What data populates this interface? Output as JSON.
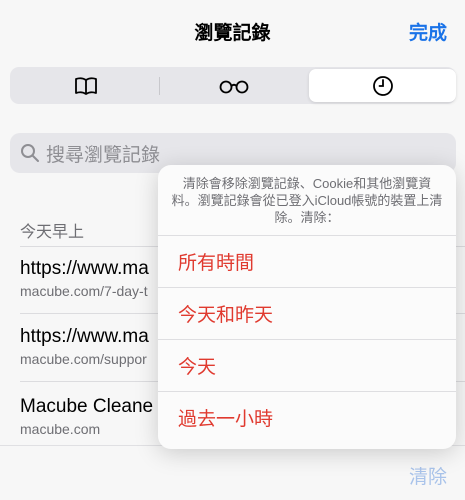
{
  "nav": {
    "title": "瀏覽記錄",
    "done_label": "完成"
  },
  "tabs": [
    {
      "icon": "book-icon"
    },
    {
      "icon": "reading-list-glasses-icon"
    },
    {
      "icon": "clock-icon",
      "selected": true
    }
  ],
  "search": {
    "placeholder": "搜尋瀏覽記錄"
  },
  "section": {
    "header": "今天早上"
  },
  "rows": [
    {
      "title": "https://www.ma",
      "subtitle": "macube.com/7-day-t"
    },
    {
      "title": "https://www.ma",
      "subtitle": "macube.com/suppor"
    },
    {
      "title": "Macube Cleane",
      "subtitle": "macube.com"
    }
  ],
  "popover": {
    "message": "清除會移除瀏覽記錄、Cookie和其他瀏覽資料。瀏覽記錄會從已登入iCloud帳號的裝置上清除。清除：",
    "options": [
      "所有時間",
      "今天和昨天",
      "今天",
      "過去一小時"
    ]
  },
  "bottom": {
    "clear_label": "清除"
  },
  "colors": {
    "accent": "#1a73e8",
    "destructive": "#e03a2f"
  }
}
